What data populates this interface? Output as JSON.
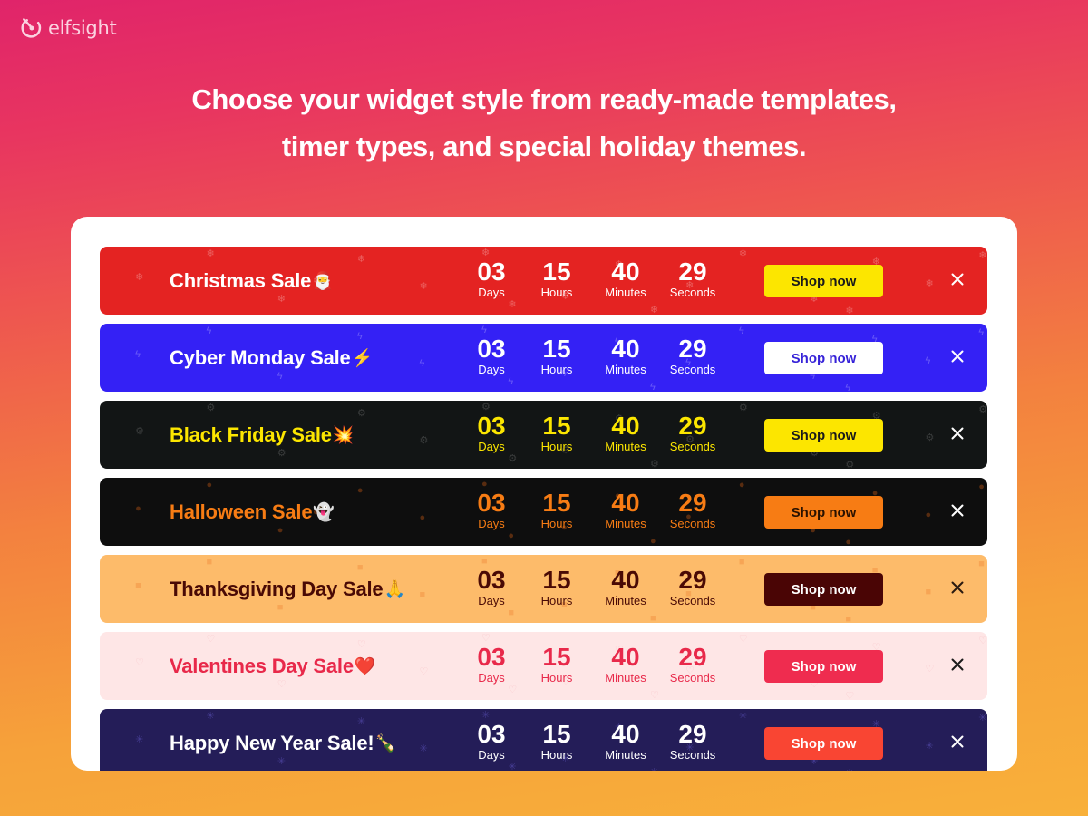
{
  "brand": {
    "name": "elfsight",
    "icon": "elfsight-logo-icon"
  },
  "headline": {
    "line1": "Choose your widget style from ready-made templates,",
    "line2": "timer types, and special holiday themes."
  },
  "timer_units": [
    "Days",
    "Hours",
    "Minutes",
    "Seconds"
  ],
  "banners": [
    {
      "title": "Christmas Sale",
      "emoji": "🎅",
      "pattern_icon": "❄",
      "timer": [
        "03",
        "15",
        "40",
        "29"
      ],
      "button_label": "Shop now",
      "colors": {
        "bg": "#e42322",
        "title": "#ffffff",
        "num": "#ffffff",
        "label": "#ffffff",
        "btn_bg": "#fce600",
        "btn_text": "#1a1a1a",
        "close": "#ffffff",
        "pattern": "rgba(255,255,255,0.28)"
      }
    },
    {
      "title": "Cyber Monday Sale",
      "emoji": "⚡",
      "pattern_icon": "ϟ",
      "timer": [
        "03",
        "15",
        "40",
        "29"
      ],
      "button_label": "Shop now",
      "colors": {
        "bg": "#3421f5",
        "title": "#ffffff",
        "num": "#ffffff",
        "label": "#ffffff",
        "btn_bg": "#ffffff",
        "btn_text": "#3622d8",
        "close": "#ffffff",
        "pattern": "rgba(255,255,255,0.25)"
      }
    },
    {
      "title": "Black Friday Sale",
      "emoji": "💥",
      "pattern_icon": "⚙",
      "timer": [
        "03",
        "15",
        "40",
        "29"
      ],
      "button_label": "Shop now",
      "colors": {
        "bg": "#121515",
        "title": "#fce600",
        "num": "#fce600",
        "label": "#fce600",
        "btn_bg": "#fce600",
        "btn_text": "#1a1a1a",
        "close": "#ffffff",
        "pattern": "rgba(255,255,255,0.16)"
      }
    },
    {
      "title": "Halloween Sale",
      "emoji": "👻",
      "pattern_icon": "●",
      "timer": [
        "03",
        "15",
        "40",
        "29"
      ],
      "button_label": "Shop now",
      "colors": {
        "bg": "#0e0e0e",
        "title": "#f77c14",
        "num": "#f77c14",
        "label": "#f77c14",
        "btn_bg": "#f77c14",
        "btn_text": "#2a1200",
        "close": "#ffffff",
        "pattern": "rgba(200,90,20,0.4)"
      }
    },
    {
      "title": "Thanksgiving Day Sale",
      "emoji": "🙏",
      "pattern_icon": "■",
      "timer": [
        "03",
        "15",
        "40",
        "29"
      ],
      "button_label": "Shop now",
      "colors": {
        "bg": "#fdbb6a",
        "title": "#4a0a05",
        "num": "#4a0a05",
        "label": "#4a0a05",
        "btn_bg": "#4a0505",
        "btn_text": "#ffffff",
        "close": "#2a1a10",
        "pattern": "rgba(240,140,60,0.45)"
      }
    },
    {
      "title": "Valentines Day Sale",
      "emoji": "❤️",
      "pattern_icon": "♡",
      "timer": [
        "03",
        "15",
        "40",
        "29"
      ],
      "button_label": "Shop now",
      "colors": {
        "bg": "#fee6e6",
        "title": "#e8294a",
        "num": "#e8294a",
        "label": "#e8294a",
        "btn_bg": "#ef2c4f",
        "btn_text": "#ffffff",
        "close": "#1a1a1a",
        "pattern": "rgba(240,150,160,0.35)"
      }
    },
    {
      "title": "Happy New Year Sale!",
      "emoji": "🍾",
      "pattern_icon": "✳",
      "timer": [
        "03",
        "15",
        "40",
        "29"
      ],
      "button_label": "Shop now",
      "colors": {
        "bg": "#241d58",
        "title": "#ffffff",
        "num": "#ffffff",
        "label": "#ffffff",
        "btn_bg": "#f94533",
        "btn_text": "#ffffff",
        "close": "#ffffff",
        "pattern": "rgba(110,100,220,0.45)"
      }
    }
  ]
}
